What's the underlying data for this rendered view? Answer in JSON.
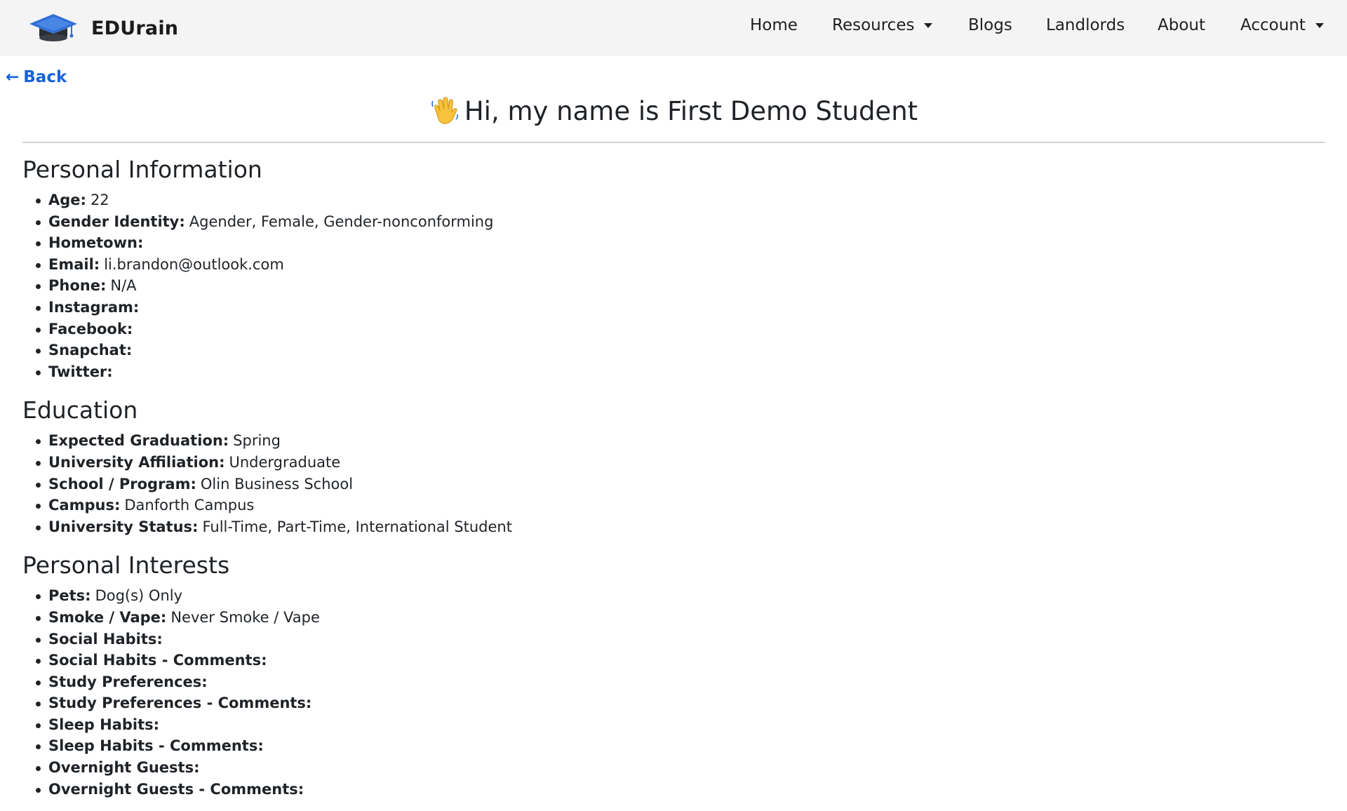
{
  "navbar": {
    "brand": "EDUrain",
    "items": [
      {
        "label": "Home"
      },
      {
        "label": "Resources"
      },
      {
        "label": "Blogs"
      },
      {
        "label": "Landlords"
      },
      {
        "label": "About"
      },
      {
        "label": "Account"
      }
    ]
  },
  "back_label": "Back",
  "title": "Hi, my name is First Demo Student",
  "sections": {
    "personal": {
      "title": "Personal Information",
      "fields": [
        {
          "label": "Age:",
          "value": "22"
        },
        {
          "label": "Gender Identity:",
          "value": "Agender, Female, Gender-nonconforming"
        },
        {
          "label": "Hometown:",
          "value": ""
        },
        {
          "label": "Email:",
          "value": "li.brandon@outlook.com"
        },
        {
          "label": "Phone:",
          "value": "N/A"
        },
        {
          "label": "Instagram:",
          "value": ""
        },
        {
          "label": "Facebook:",
          "value": ""
        },
        {
          "label": "Snapchat:",
          "value": ""
        },
        {
          "label": "Twitter:",
          "value": ""
        }
      ]
    },
    "education": {
      "title": "Education",
      "fields": [
        {
          "label": "Expected Graduation:",
          "value": "Spring"
        },
        {
          "label": "University Affiliation:",
          "value": "Undergraduate"
        },
        {
          "label": "School / Program:",
          "value": "Olin Business School"
        },
        {
          "label": "Campus:",
          "value": "Danforth Campus"
        },
        {
          "label": "University Status:",
          "value": "Full-Time, Part-Time, International Student"
        }
      ]
    },
    "interests": {
      "title": "Personal Interests",
      "fields": [
        {
          "label": "Pets:",
          "value": "Dog(s) Only"
        },
        {
          "label": "Smoke / Vape:",
          "value": "Never Smoke / Vape"
        },
        {
          "label": "Social Habits:",
          "value": ""
        },
        {
          "label": "Social Habits - Comments:",
          "value": ""
        },
        {
          "label": "Study Preferences:",
          "value": ""
        },
        {
          "label": "Study Preferences - Comments:",
          "value": ""
        },
        {
          "label": "Sleep Habits:",
          "value": ""
        },
        {
          "label": "Sleep Habits - Comments:",
          "value": ""
        },
        {
          "label": "Overnight Guests:",
          "value": ""
        },
        {
          "label": "Overnight Guests - Comments:",
          "value": ""
        }
      ]
    }
  },
  "colors": {
    "navbar_bg": "#f4f4f4",
    "link_blue": "#1463d6",
    "logo_blue": "#2f6fd6",
    "text": "#1f2327"
  },
  "icons": {
    "logo": "graduation-cap-icon",
    "wave": "waving-hand-icon",
    "back": "left-arrow-icon",
    "dropdown": "caret-down-icon"
  }
}
